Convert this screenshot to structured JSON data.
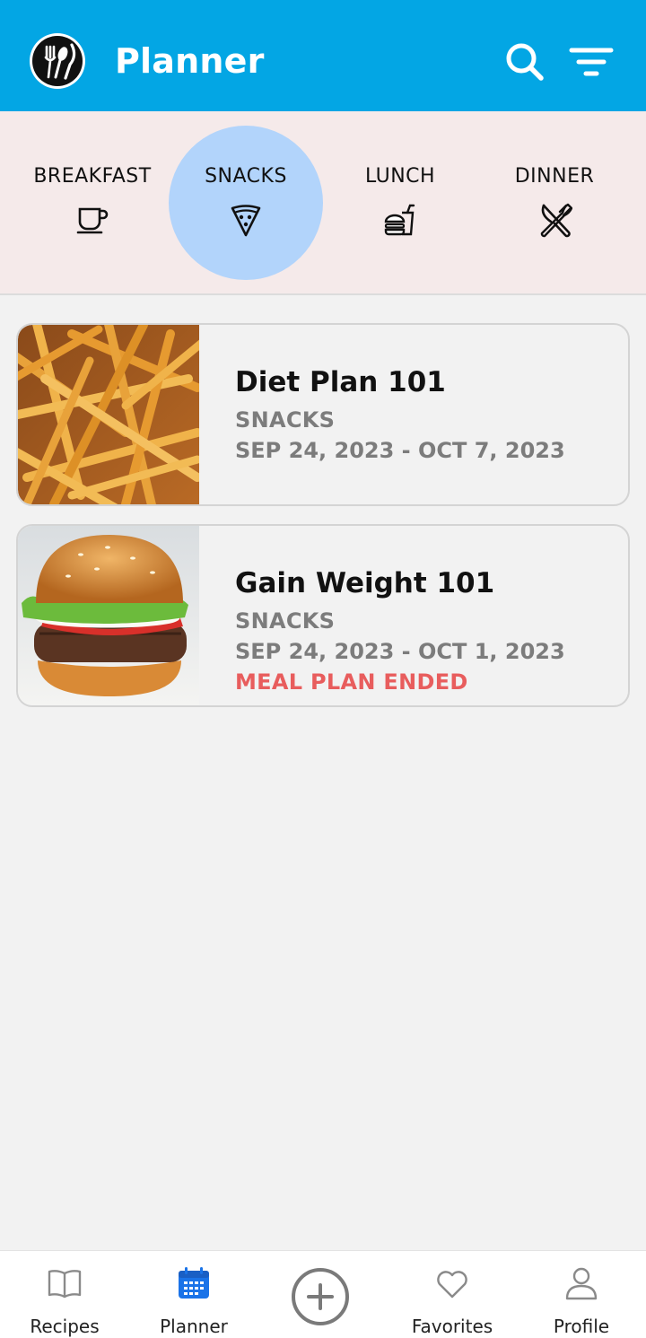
{
  "header": {
    "title": "Planner",
    "logo_icon": "utensils-logo-icon",
    "search_icon": "search-icon",
    "filter_icon": "filter-icon",
    "background_color": "#03a6e4"
  },
  "tabs": [
    {
      "label": "BREAKFAST",
      "icon": "coffee-cup-icon",
      "active": false
    },
    {
      "label": "SNACKS",
      "icon": "pizza-slice-icon",
      "active": true
    },
    {
      "label": "LUNCH",
      "icon": "burger-drink-icon",
      "active": false
    },
    {
      "label": "DINNER",
      "icon": "fork-knife-icon",
      "active": false
    }
  ],
  "plans": [
    {
      "name": "Diet Plan 101",
      "category": "SNACKS",
      "dates": "SEP 24, 2023 - OCT 7, 2023",
      "status": "",
      "image": "french-fries"
    },
    {
      "name": "Gain Weight 101",
      "category": "SNACKS",
      "dates": "SEP 24, 2023 - OCT 1, 2023",
      "status": "MEAL PLAN ENDED",
      "image": "hamburger"
    }
  ],
  "bottom_nav": [
    {
      "label": "Recipes",
      "icon": "book-icon",
      "active": false
    },
    {
      "label": "Planner",
      "icon": "calendar-icon",
      "active": true
    },
    {
      "label": "",
      "icon": "add-circle-icon",
      "active": false
    },
    {
      "label": "Favorites",
      "icon": "heart-icon",
      "active": false
    },
    {
      "label": "Profile",
      "icon": "user-icon",
      "active": false
    }
  ],
  "colors": {
    "accent": "#03a6e4",
    "active_tab": "#b2d4fb",
    "ended": "#e85d5d",
    "nav_active": "#1a73e8"
  }
}
